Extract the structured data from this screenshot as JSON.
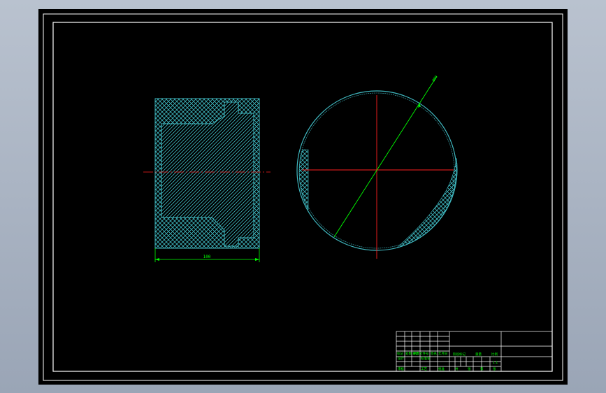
{
  "colors": {
    "background": "#000000",
    "border": "#ffffff",
    "hatch": "#3fb8c0",
    "centerline": "#ff2020",
    "dimension": "#00ff00"
  },
  "section_view": {
    "width_dimension": "100"
  },
  "circle_view": {
    "diameter_dimension": "Ø80"
  },
  "title_block": {
    "row_labels": [
      "标记",
      "处数",
      "分区",
      "更改文件号",
      "签名",
      "年月日"
    ],
    "left_labels": [
      "设计",
      "标准化"
    ],
    "mid_header": [
      "阶段标记",
      "重量",
      "比例"
    ],
    "scale_value": "1:1",
    "sheet_labels": [
      "共",
      "张",
      "第",
      "张"
    ],
    "approve_label": "批准",
    "review_label": "审核",
    "process_label": "工艺"
  }
}
